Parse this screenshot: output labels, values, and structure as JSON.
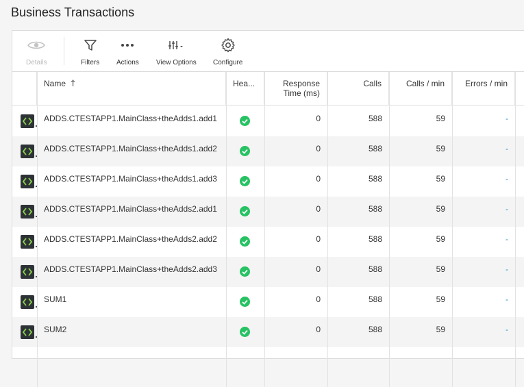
{
  "page": {
    "title": "Business Transactions"
  },
  "toolbar": {
    "details": "Details",
    "filters": "Filters",
    "actions": "Actions",
    "view_options": "View Options",
    "configure": "Configure"
  },
  "table": {
    "headers": {
      "name": "Name",
      "health": "Hea...",
      "response_time_line1": "Response",
      "response_time_line2": "Time (ms)",
      "calls": "Calls",
      "calls_per_min": "Calls / min",
      "errors_per_min": "Errors / min"
    },
    "rows": [
      {
        "name": "ADDS.CTESTAPP1.MainClass+theAdds1.add1",
        "response": "0",
        "calls": "588",
        "cpm": "59",
        "epm": "-"
      },
      {
        "name": "ADDS.CTESTAPP1.MainClass+theAdds1.add2",
        "response": "0",
        "calls": "588",
        "cpm": "59",
        "epm": "-"
      },
      {
        "name": "ADDS.CTESTAPP1.MainClass+theAdds1.add3",
        "response": "0",
        "calls": "588",
        "cpm": "59",
        "epm": "-"
      },
      {
        "name": "ADDS.CTESTAPP1.MainClass+theAdds2.add1",
        "response": "0",
        "calls": "588",
        "cpm": "59",
        "epm": "-"
      },
      {
        "name": "ADDS.CTESTAPP1.MainClass+theAdds2.add2",
        "response": "0",
        "calls": "588",
        "cpm": "59",
        "epm": "-"
      },
      {
        "name": "ADDS.CTESTAPP1.MainClass+theAdds2.add3",
        "response": "0",
        "calls": "588",
        "cpm": "59",
        "epm": "-"
      },
      {
        "name": "SUM1",
        "response": "0",
        "calls": "588",
        "cpm": "59",
        "epm": "-"
      },
      {
        "name": "SUM2",
        "response": "0",
        "calls": "588",
        "cpm": "59",
        "epm": "-"
      }
    ]
  },
  "colors": {
    "health_ok": "#27c263",
    "link": "#2b8ac6",
    "icon_bg": "#2d3236",
    "icon_fg": "#8bd34a"
  }
}
